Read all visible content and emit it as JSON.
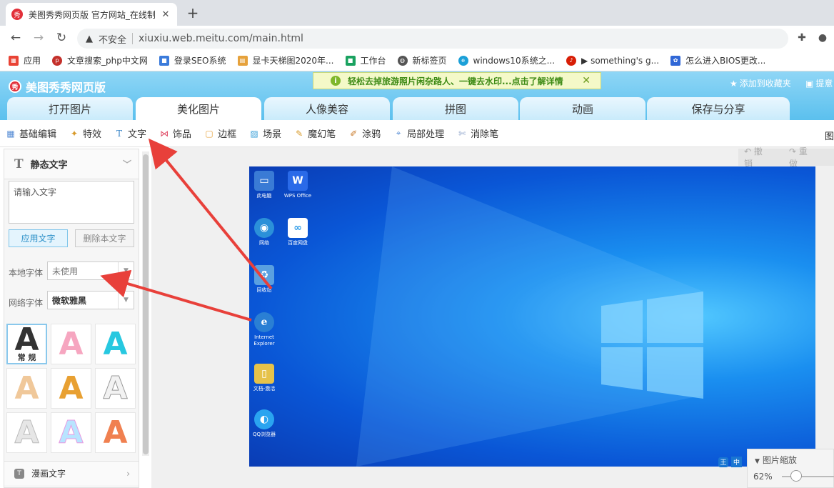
{
  "browser": {
    "tab_title": "美图秀秀网页版 官方网站_在线制",
    "tab_icon_label": "秀",
    "insecure_label": "不安全",
    "url": "xiuxiu.web.meitu.com/main.html"
  },
  "bookmarks": [
    {
      "label": "应用",
      "color": "#e94335"
    },
    {
      "label": "文章搜索_php中文网",
      "color": "#c4302b"
    },
    {
      "label": "登录SEO系统",
      "color": "#3b7bdb"
    },
    {
      "label": "显卡天梯图2020年...",
      "color": "#e6a23c"
    },
    {
      "label": "工作台",
      "color": "#1aa260"
    },
    {
      "label": "新标签页",
      "color": "#555555"
    },
    {
      "label": "windows10系统之...",
      "color": "#1ba0d8"
    },
    {
      "label": "▶ something's g...",
      "color": "#d81e06"
    },
    {
      "label": "怎么进入BIOS更改...",
      "color": "#3067d6"
    }
  ],
  "app": {
    "logo_text": "美图秀秀网页版",
    "promo_text": "轻松去掉旅游照片闲杂路人、一键去水印...点击了解详情",
    "favorite_label": "添加到收藏夹",
    "feedback_label": "提意",
    "main_tabs": [
      "打开图片",
      "美化图片",
      "人像美容",
      "拼图",
      "动画",
      "保存与分享"
    ],
    "active_tab": 1
  },
  "toolbar": {
    "items": [
      {
        "label": "基础编辑",
        "icon": "grid-icon",
        "color": "#5a8fd6"
      },
      {
        "label": "特效",
        "icon": "magic-icon",
        "color": "#d89a2a"
      },
      {
        "label": "文字",
        "icon": "text-icon",
        "color": "#3a86c8"
      },
      {
        "label": "饰品",
        "icon": "bow-icon",
        "color": "#e0506a"
      },
      {
        "label": "边框",
        "icon": "frame-icon",
        "color": "#e6a23c"
      },
      {
        "label": "场景",
        "icon": "scene-icon",
        "color": "#3aa0d8"
      },
      {
        "label": "魔幻笔",
        "icon": "pen-icon",
        "color": "#d89a2a"
      },
      {
        "label": "涂鸦",
        "icon": "brush-icon",
        "color": "#c87a2a"
      },
      {
        "label": "局部处理",
        "icon": "local-icon",
        "color": "#5a8fd6"
      },
      {
        "label": "消除笔",
        "icon": "eraser-icon",
        "color": "#8aa0c8"
      }
    ],
    "right_label": "图"
  },
  "panel": {
    "title": "静态文字",
    "input_placeholder": "请输入文字",
    "apply_label": "应用文字",
    "delete_label": "删除本文字",
    "local_font_label": "本地字体",
    "local_font_value": "未使用",
    "web_font_label": "网络字体",
    "web_font_value": "微软雅黑",
    "style_normal_caption": "常 规",
    "footer_label": "漫画文字"
  },
  "canvas": {
    "undo_label": "撤销",
    "redo_label": "重做",
    "desktop_icons": [
      {
        "label": "此电脑",
        "color": "#3a7bd5",
        "glyph": "▭"
      },
      {
        "label": "WPS Office",
        "color": "#2a6ae8",
        "glyph": "W"
      },
      {
        "label": "网络",
        "color": "#2b90d9",
        "glyph": "◉"
      },
      {
        "label": "百度网盘",
        "color": "#ffffff",
        "glyph": "∞"
      },
      {
        "label": "回收站",
        "color": "#5aa0e0",
        "glyph": "♻"
      },
      {
        "label": "Internet Explorer",
        "color": "#2a7fd4",
        "glyph": "e"
      },
      {
        "label": "文档-激活",
        "color": "#e6c24a",
        "glyph": "▯"
      },
      {
        "label": "QQ浏览器",
        "color": "#2aa4f0",
        "glyph": "◐"
      }
    ],
    "ime_label": "中",
    "zoom_title": "图片缩放",
    "zoom_value": "62%",
    "zoom_level_pct": 62,
    "arrow_color": "#e8403a"
  }
}
